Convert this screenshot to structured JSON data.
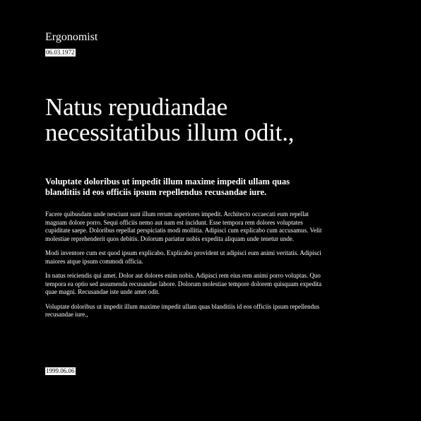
{
  "author": "Ergonomist",
  "date_top": "06.03.1972",
  "headline": "Natus repudiandae necessitatibus illum odit.,",
  "subtitle": "Voluptate doloribus ut impedit illum maxime impedit ullam quas blanditiis id eos officiis ipsum repellendus recusandae iure.",
  "paragraphs": [
    "Facere quibusdam unde nesciunt sunt illum rerum asperiores impedit. Architecto occaecati eum repellat magnam dolore porro. Sequi officiis nemo aut nam est incidunt. Esse tempora rem dolores voluptates cupiditate saepe. Doloribus repellat perspiciatis modi mollitia. Adipisci cum explicabo cum accusamus. Velit molestiae reprehenderit quos debitis. Dolorum pariatur nobis expedita aliquam unde tenetur unde.",
    "Modi inventore cum est quod ipsum explicabo. Explicabo provident ut adipisci eum animi veritatis. Adipisci maiores atque ipsum commodi officia.",
    "In natus reiciendis qui amet. Dolor aut dolores enim nobis. Adipisci rem eius rem animi porro voluptas. Quo tempora ea optio sed assumenda recusandae labore. Dolorum molestiae tempore dolorem quisquam expedita quae magni. Recusandae iste unde amet odit.",
    "Voluptate doloribus ut impedit illum maxime impedit ullam quas blanditiis id eos officiis ipsum repellendus recusandae iure.,"
  ],
  "date_bottom": "1999.06.06",
  "colors": {
    "background": "#000000",
    "text": "#ffffff",
    "badge_background": "#ffffff",
    "badge_text": "#000000"
  }
}
